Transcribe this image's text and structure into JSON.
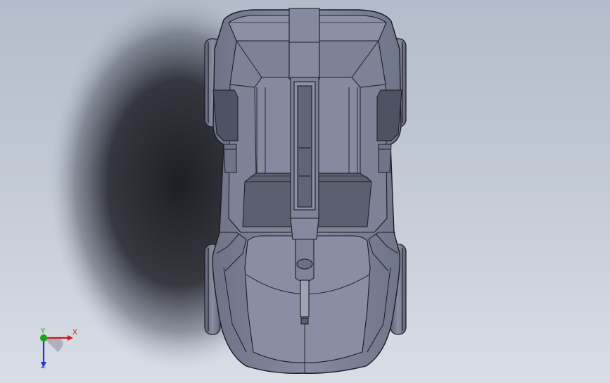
{
  "viewport": {
    "background_top": "#b4bccb",
    "background_bottom": "#d9dee6"
  },
  "model": {
    "body_color": "#7c8196",
    "edge_color": "#1b1c24"
  },
  "triad": {
    "x_label": "X",
    "y_label": "Y",
    "z_label": "Z",
    "x_color": "#d11a1a",
    "y_color": "#1aa01a",
    "z_color": "#2038c8"
  }
}
